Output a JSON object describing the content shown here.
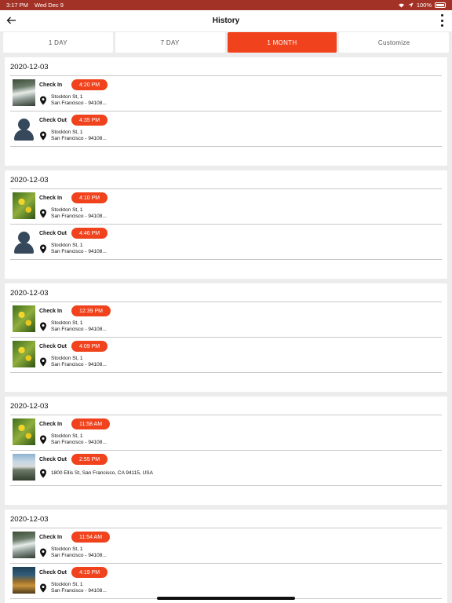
{
  "status": {
    "time": "3:17 PM",
    "date": "Wed Dec 9",
    "battery": "100%"
  },
  "header": {
    "title": "History"
  },
  "tabs": [
    {
      "label": "1 DAY"
    },
    {
      "label": "7 DAY"
    },
    {
      "label": "1 MONTH"
    },
    {
      "label": "Customize"
    }
  ],
  "cards": [
    {
      "date": "2020-12-03",
      "entries": [
        {
          "type": "Check In",
          "time": "4:20 PM",
          "line1": "Stockton St, 1",
          "line2": "San Francisco - 94108..."
        },
        {
          "type": "Check Out",
          "time": "4:35 PM",
          "line1": "Stockton St, 1",
          "line2": "San Francisco - 94108..."
        }
      ]
    },
    {
      "date": "2020-12-03",
      "entries": [
        {
          "type": "Check In",
          "time": "4:10 PM",
          "line1": "Stockton St, 1",
          "line2": "San Francisco - 94108..."
        },
        {
          "type": "Check Out",
          "time": "4:46 PM",
          "line1": "Stockton St, 1",
          "line2": "San Francisco - 94108..."
        }
      ]
    },
    {
      "date": "2020-12-03",
      "entries": [
        {
          "type": "Check In",
          "time": "12:39 PM",
          "line1": "Stockton St, 1",
          "line2": "San Francisco - 94108..."
        },
        {
          "type": "Check Out",
          "time": "4:09 PM",
          "line1": "Stockton St, 1",
          "line2": "San Francisco - 94108..."
        }
      ]
    },
    {
      "date": "2020-12-03",
      "entries": [
        {
          "type": "Check In",
          "time": "11:58 AM",
          "line1": "Stockton St, 1",
          "line2": "San Francisco - 94108..."
        },
        {
          "type": "Check Out",
          "time": "2:55 PM",
          "line1": "1800 Ellis St, San Francisco, CA 94115, USA",
          "line2": ""
        }
      ]
    },
    {
      "date": "2020-12-03",
      "entries": [
        {
          "type": "Check In",
          "time": "11:54 AM",
          "line1": "Stockton St, 1",
          "line2": "San Francisco - 94108..."
        },
        {
          "type": "Check Out",
          "time": "4:19 PM",
          "line1": "Stockton St, 1",
          "line2": "San Francisco - 94108..."
        }
      ]
    }
  ]
}
